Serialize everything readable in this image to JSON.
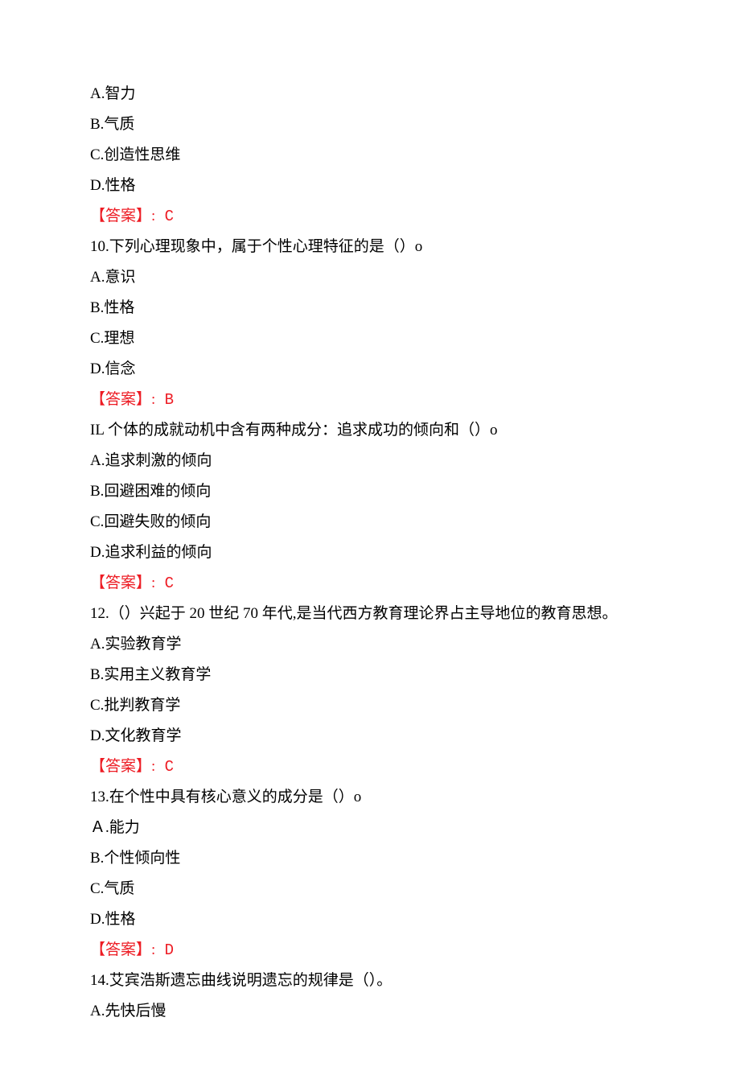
{
  "q9": {
    "a": "A.智力",
    "b": "B.气质",
    "c": "C.创造性思维",
    "d": "D.性格",
    "ans_prefix": "【答案】:",
    "ans": " C"
  },
  "q10": {
    "stem": "10.下列心理现象中，属于个性心理特征的是（）o",
    "a": "A.意识",
    "b": "B.性格",
    "c": "C.理想",
    "d": "D.信念",
    "ans_prefix": "【答案】:",
    "ans": " B"
  },
  "q11": {
    "stem": "IL 个体的成就动机中含有两种成分：追求成功的倾向和（）o",
    "a": "A.追求刺激的倾向",
    "b": "B.回避困难的倾向",
    "c": "C.回避失败的倾向",
    "d": "D.追求利益的倾向",
    "ans_prefix": "【答案】:",
    "ans": " C"
  },
  "q12": {
    "stem": "12.（）兴起于 20 世纪 70 年代,是当代西方教育理论界占主导地位的教育思想。",
    "a": "A.实验教育学",
    "b": "B.实用主义教育学",
    "c": "C.批判教育学",
    "d": "D.文化教育学",
    "ans_prefix": "【答案】:",
    "ans": " C"
  },
  "q13": {
    "stem": "13.在个性中具有核心意义的成分是（）o",
    "a": "Ａ.能力",
    "b": "B.个性倾向性",
    "c": "C.气质",
    "d": "D.性格",
    "ans_prefix": "【答案】:",
    "ans": " D"
  },
  "q14": {
    "stem": "14.艾宾浩斯遗忘曲线说明遗忘的规律是（）。",
    "a": "A.先快后慢"
  }
}
